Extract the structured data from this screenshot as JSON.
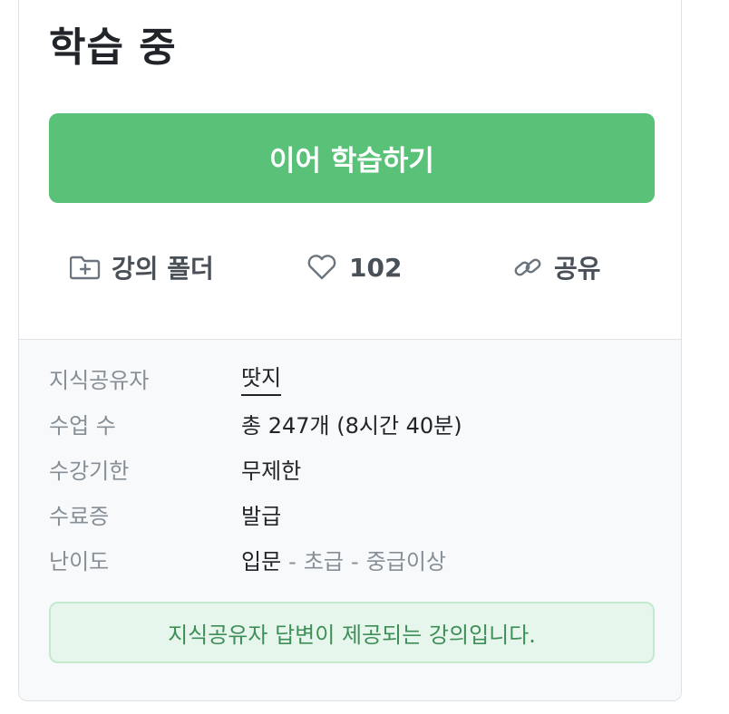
{
  "header": {
    "title": "학습 중"
  },
  "cta": {
    "label": "이어 학습하기"
  },
  "actions": {
    "folder": {
      "label": "강의 폴더",
      "icon": "folder-plus-icon"
    },
    "like": {
      "count": "102",
      "icon": "heart-icon"
    },
    "share": {
      "label": "공유",
      "icon": "link-icon"
    }
  },
  "info": {
    "instructor": {
      "label": "지식공유자",
      "value": "땃지"
    },
    "lessons": {
      "label": "수업 수",
      "value": "총 247개 (8시간 40분)"
    },
    "period": {
      "label": "수강기한",
      "value": "무제한"
    },
    "certificate": {
      "label": "수료증",
      "value": "발급"
    },
    "level": {
      "label": "난이도",
      "items": [
        "입문",
        "초급",
        "중급이상"
      ],
      "separator": "-"
    }
  },
  "notice": {
    "text": "지식공유자 답변이 제공되는 강의입니다."
  },
  "colors": {
    "primary": "#5ac278",
    "notice_bg": "#e7f6ec",
    "notice_text": "#3e8e58",
    "label_gray": "#868e96"
  }
}
